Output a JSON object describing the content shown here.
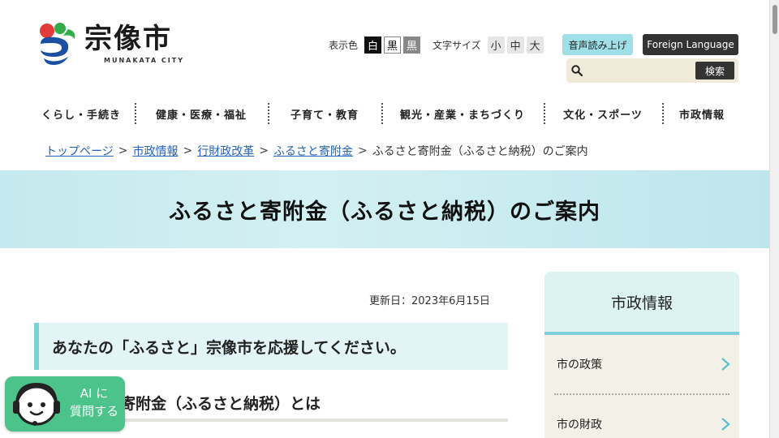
{
  "header": {
    "logo_text": "宗像市",
    "logo_sub": "MUNAKATA CITY",
    "color_label": "表示色",
    "color_buttons": [
      "白",
      "黒",
      "黒"
    ],
    "font_label": "文字サイズ",
    "font_buttons": [
      "小",
      "中",
      "大"
    ],
    "voice_button": "音声読み上げ",
    "language_button": "Foreign Language",
    "search_placeholder": "",
    "search_button": "検索"
  },
  "nav": {
    "items": [
      "くらし・手続き",
      "健康・医療・福祉",
      "子育て・教育",
      "観光・産業・まちづくり",
      "文化・スポーツ",
      "市政情報"
    ]
  },
  "breadcrumb": {
    "links": [
      "トップページ",
      "市政情報",
      "行財政改革",
      "ふるさと寄附金"
    ],
    "separator": ">",
    "current": "ふるさと寄附金（ふるさと納税）のご案内"
  },
  "main": {
    "title": "ふるさと寄附金（ふるさと納税）のご案内",
    "updated": "更新日：2023年6月15日",
    "heading2": "あなたの「ふるさと」宗像市を応援してください。",
    "heading3": "寄附金（ふるさと納税）とは"
  },
  "side": {
    "heading": "市政情報",
    "items": [
      "市の政策",
      "市の財政"
    ]
  },
  "ai_widget": {
    "label": "AI に\n質問する"
  },
  "colors": {
    "accent": "#7dcfd8",
    "title_band": "#c4e9ee",
    "link": "#2563b8",
    "ai_green": "#4cc38a"
  }
}
